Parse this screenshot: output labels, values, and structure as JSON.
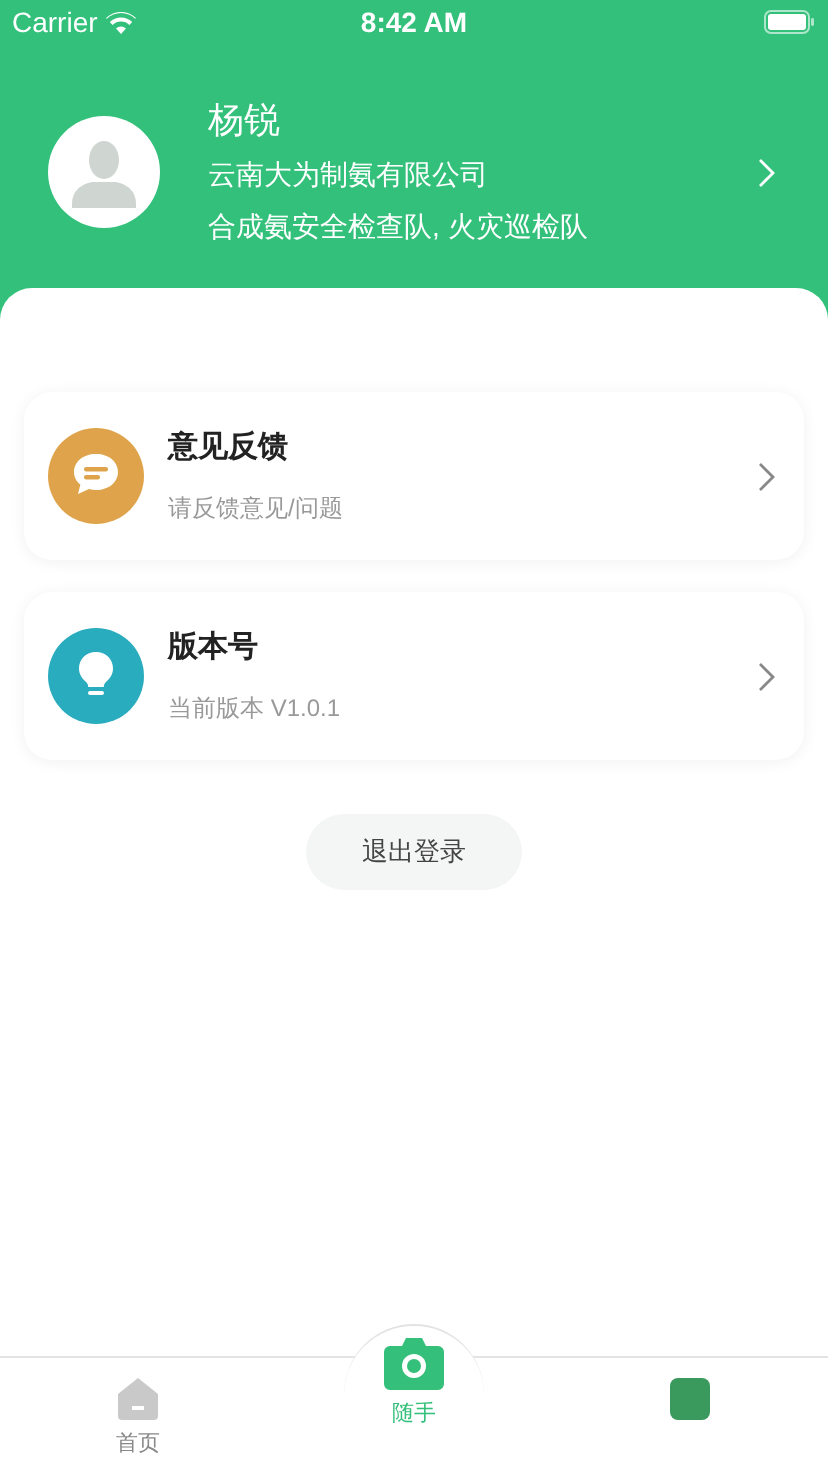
{
  "status_bar": {
    "carrier": "Carrier",
    "time": "8:42 AM"
  },
  "profile": {
    "name": "杨锐",
    "company": "云南大为制氨有限公司",
    "teams": "合成氨安全检查队, 火灾巡检队"
  },
  "menu": [
    {
      "kind": "feedback",
      "title": "意见反馈",
      "subtitle": "请反馈意见/问题",
      "color": "#dfa44b"
    },
    {
      "kind": "version",
      "title": "版本号",
      "subtitle": "当前版本 V1.0.1",
      "color": "#2aacbf"
    }
  ],
  "logout": "退出登录",
  "tabs": [
    {
      "kind": "home",
      "label": "首页",
      "selected": false
    },
    {
      "kind": "camera",
      "label": "随手",
      "selected": true
    },
    {
      "kind": "other",
      "selected": false
    }
  ]
}
